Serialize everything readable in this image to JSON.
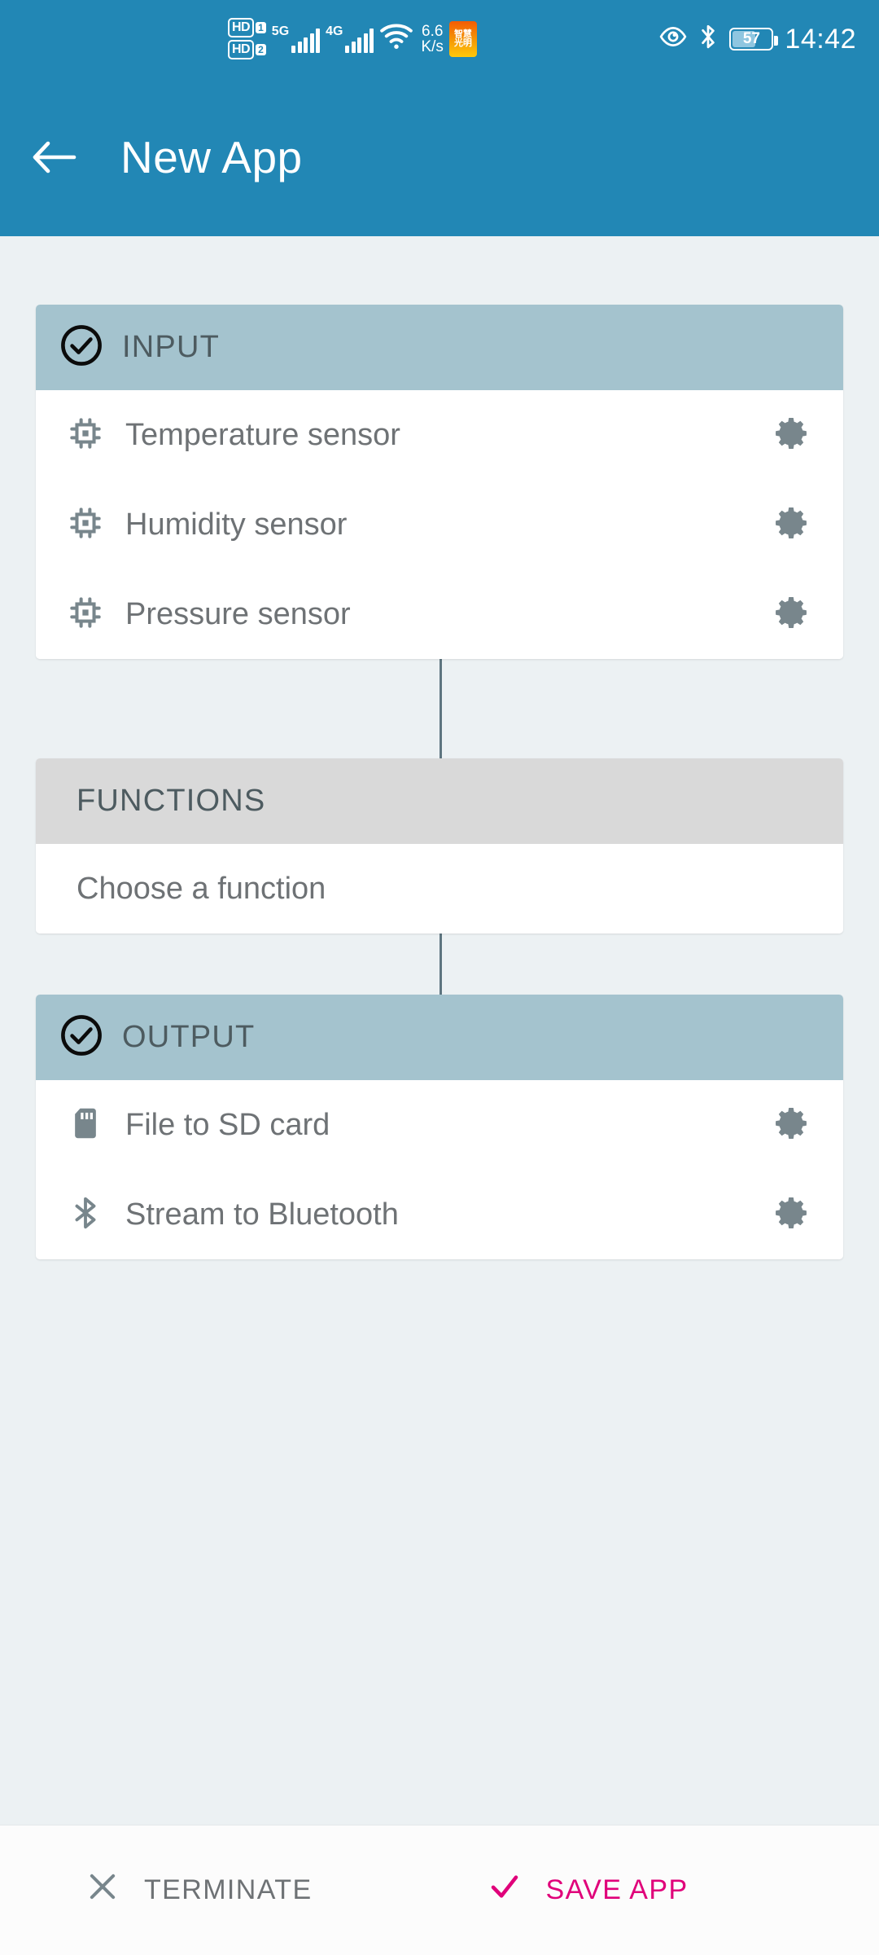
{
  "statusbar": {
    "hd1_label": "HD",
    "hd1_num": "1",
    "hd2_label": "HD",
    "hd2_num": "2",
    "net1": "5G",
    "net2": "4G",
    "speed_value": "6.6",
    "speed_unit": "K/s",
    "app_badge_line1": "智慧",
    "app_badge_line2": "光明",
    "battery_percent": "57",
    "time": "14:42",
    "icons": {
      "eye": "eye-icon",
      "bluetooth": "bluetooth-icon",
      "wifi": "wifi-icon",
      "battery": "battery-icon"
    }
  },
  "appbar": {
    "back_icon": "back-arrow-icon",
    "title": "New App"
  },
  "colors": {
    "primary": "#2287B5",
    "section_header": "#A4C3CE",
    "section_header_inactive": "#D9D9D9",
    "page_background": "#ECF1F3",
    "accent_pink": "#E0007A",
    "icon_grey": "#78868C",
    "text_grey": "#6E7275"
  },
  "sections": [
    {
      "id": "input",
      "title": "INPUT",
      "checked": true,
      "check_icon": "check-circle-icon",
      "rows": [
        {
          "label": "Temperature sensor",
          "icon": "chip-icon",
          "action_icon": "gear-icon"
        },
        {
          "label": "Humidity sensor",
          "icon": "chip-icon",
          "action_icon": "gear-icon"
        },
        {
          "label": "Pressure sensor",
          "icon": "chip-icon",
          "action_icon": "gear-icon"
        }
      ]
    },
    {
      "id": "functions",
      "title": "FUNCTIONS",
      "checked": false,
      "placeholder": "Choose a function"
    },
    {
      "id": "output",
      "title": "OUTPUT",
      "checked": true,
      "check_icon": "check-circle-icon",
      "rows": [
        {
          "label": "File to SD card",
          "icon": "sd-card-icon",
          "action_icon": "gear-icon"
        },
        {
          "label": "Stream to Bluetooth",
          "icon": "bluetooth-icon",
          "action_icon": "gear-icon"
        }
      ]
    }
  ],
  "bottombar": {
    "terminate_label": "TERMINATE",
    "terminate_icon": "close-x-icon",
    "save_label": "SAVE APP",
    "save_icon": "check-icon"
  }
}
